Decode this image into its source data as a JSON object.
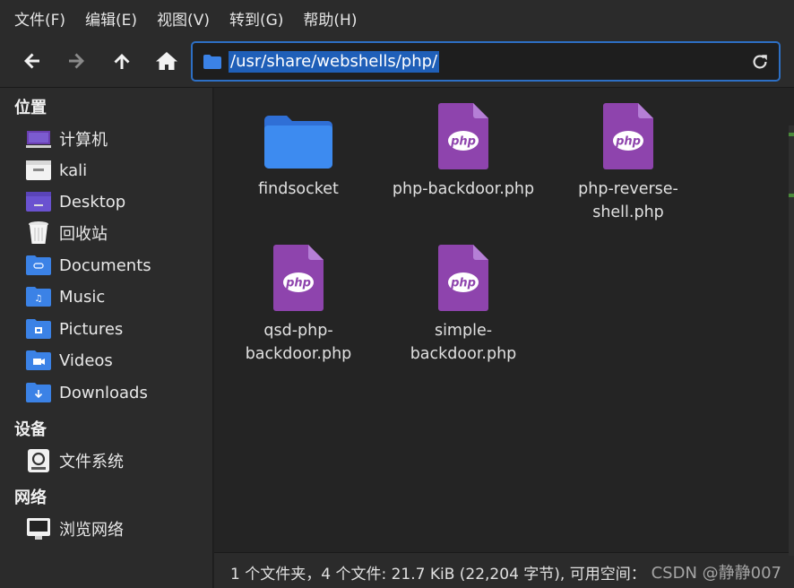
{
  "menubar": {
    "items": [
      "文件(F)",
      "编辑(E)",
      "视图(V)",
      "转到(G)",
      "帮助(H)"
    ]
  },
  "toolbar": {
    "back_icon": "back-arrow-icon",
    "forward_icon": "forward-arrow-icon",
    "up_icon": "up-arrow-icon",
    "home_icon": "home-icon",
    "path": "/usr/share/webshells/php/",
    "reload_icon": "reload-icon"
  },
  "sidebar": {
    "places_title": "位置",
    "places": [
      {
        "label": "计算机",
        "icon": "computer-icon"
      },
      {
        "label": "kali",
        "icon": "home-folder-icon"
      },
      {
        "label": "Desktop",
        "icon": "desktop-folder-icon"
      },
      {
        "label": "回收站",
        "icon": "trash-icon"
      },
      {
        "label": "Documents",
        "icon": "documents-folder-icon"
      },
      {
        "label": "Music",
        "icon": "music-folder-icon"
      },
      {
        "label": "Pictures",
        "icon": "pictures-folder-icon"
      },
      {
        "label": "Videos",
        "icon": "videos-folder-icon"
      },
      {
        "label": "Downloads",
        "icon": "downloads-folder-icon"
      }
    ],
    "devices_title": "设备",
    "devices": [
      {
        "label": "文件系统",
        "icon": "drive-icon"
      }
    ],
    "network_title": "网络",
    "network": [
      {
        "label": "浏览网络",
        "icon": "network-icon"
      }
    ]
  },
  "files": [
    {
      "name_lines": [
        "findsocket"
      ],
      "icon": "folder-icon"
    },
    {
      "name_lines": [
        "php-backdoor.php"
      ],
      "icon": "php-file-icon"
    },
    {
      "name_lines": [
        "php-reverse-",
        "shell.php"
      ],
      "icon": "php-file-icon"
    },
    {
      "name_lines": [
        "qsd-php-",
        "backdoor.php"
      ],
      "icon": "php-file-icon"
    },
    {
      "name_lines": [
        "simple-",
        "backdoor.php"
      ],
      "icon": "php-file-icon"
    }
  ],
  "file_icon_label": "php",
  "statusbar": {
    "text": "1 个文件夹，4 个文件: 21.7 KiB (22,204 字节), 可用空间：",
    "watermark": "CSDN @静静007"
  },
  "colors": {
    "accent": "#2d6fc4",
    "folder": "#3b82e6",
    "php": "#8e44ad"
  }
}
